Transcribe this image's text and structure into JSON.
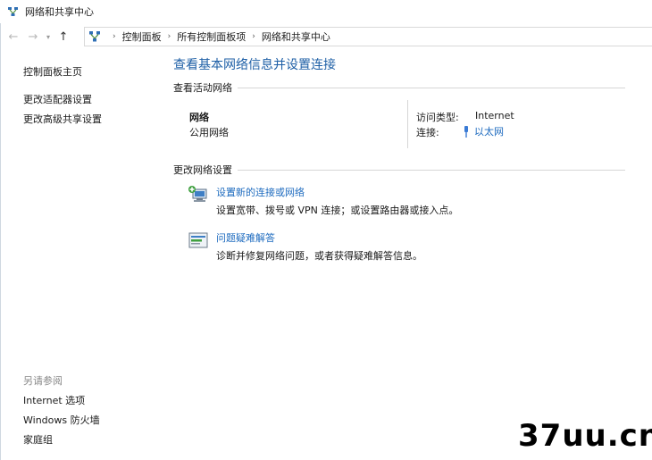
{
  "window": {
    "title": "网络和共享中心"
  },
  "address": {
    "crumbs": [
      "控制面板",
      "所有控制面板项",
      "网络和共享中心"
    ],
    "back_icon": "back-arrow-icon",
    "forward_icon": "forward-arrow-icon",
    "up_icon": "up-arrow-icon"
  },
  "sidebar": {
    "links": [
      "控制面板主页",
      "更改适配器设置",
      "更改高级共享设置"
    ],
    "see_also_title": "另请参阅",
    "see_also_links": [
      "Internet 选项",
      "Windows 防火墙",
      "家庭组"
    ]
  },
  "main": {
    "title": "查看基本网络信息并设置连接",
    "active_section": "查看活动网络",
    "network": {
      "name": "网络",
      "type": "公用网络",
      "access_label": "访问类型:",
      "access_value": "Internet",
      "connection_label": "连接:",
      "connection_value": "以太网"
    },
    "settings_section": "更改网络设置",
    "tasks": [
      {
        "title": "设置新的连接或网络",
        "desc": "设置宽带、拨号或 VPN 连接；或设置路由器或接入点。",
        "icon": "new-connection-icon"
      },
      {
        "title": "问题疑难解答",
        "desc": "诊断并修复网络问题，或者获得疑难解答信息。",
        "icon": "troubleshoot-icon"
      }
    ]
  },
  "watermark": "37uu.cn",
  "colors": {
    "link": "#1e6bbf",
    "title": "#1e5fa6"
  }
}
